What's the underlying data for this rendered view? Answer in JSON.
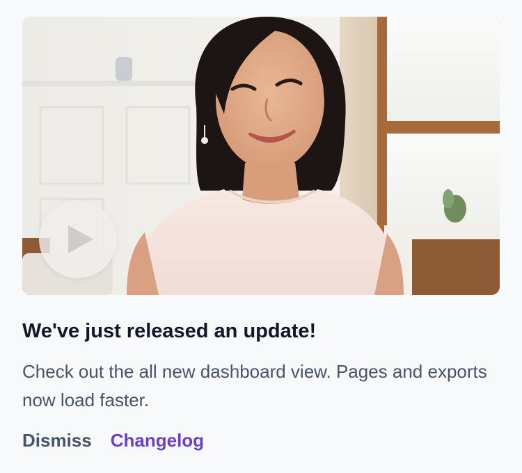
{
  "card": {
    "title": "We've just released an update!",
    "description": "Check out the all new dashboard view. Pages and exports now load faster.",
    "dismiss_label": "Dismiss",
    "changelog_label": "Changelog"
  },
  "media": {
    "play_icon": "play-icon",
    "image_subject": "smiling-woman-portrait"
  },
  "colors": {
    "title": "#101828",
    "body_text": "#475467",
    "link_accent": "#6941c6",
    "background": "#f8f9fb"
  }
}
